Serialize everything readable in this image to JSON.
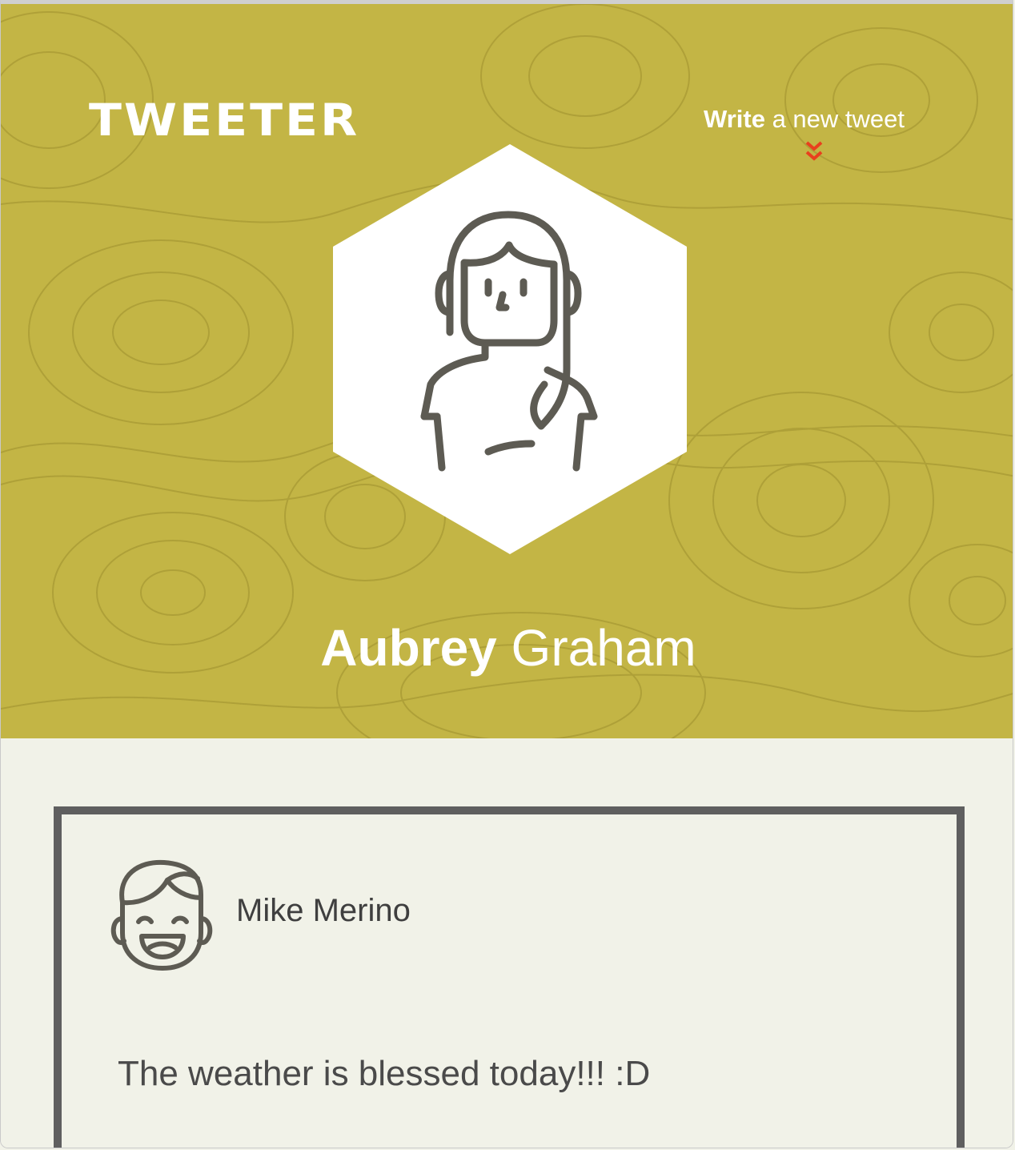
{
  "app": {
    "brand": "TWEETER"
  },
  "header": {
    "write_link_bold": "Write",
    "write_link_rest": " a new tweet",
    "user_first_name": "Aubrey",
    "user_last_name": " Graham"
  },
  "tweets": [
    {
      "author": "Mike Merino",
      "text": "The weather is blessed today!!! :D"
    }
  ],
  "colors": {
    "header_bg": "#c3b545",
    "page_bg": "#f1f2e8",
    "accent_chevron": "#e8401e",
    "card_border": "#5f5f5f"
  },
  "icons": {
    "profile_avatar": "woman-avatar-icon",
    "tweet_avatar": "laughing-man-avatar-icon",
    "write_indicator": "double-chevron-down-icon"
  }
}
